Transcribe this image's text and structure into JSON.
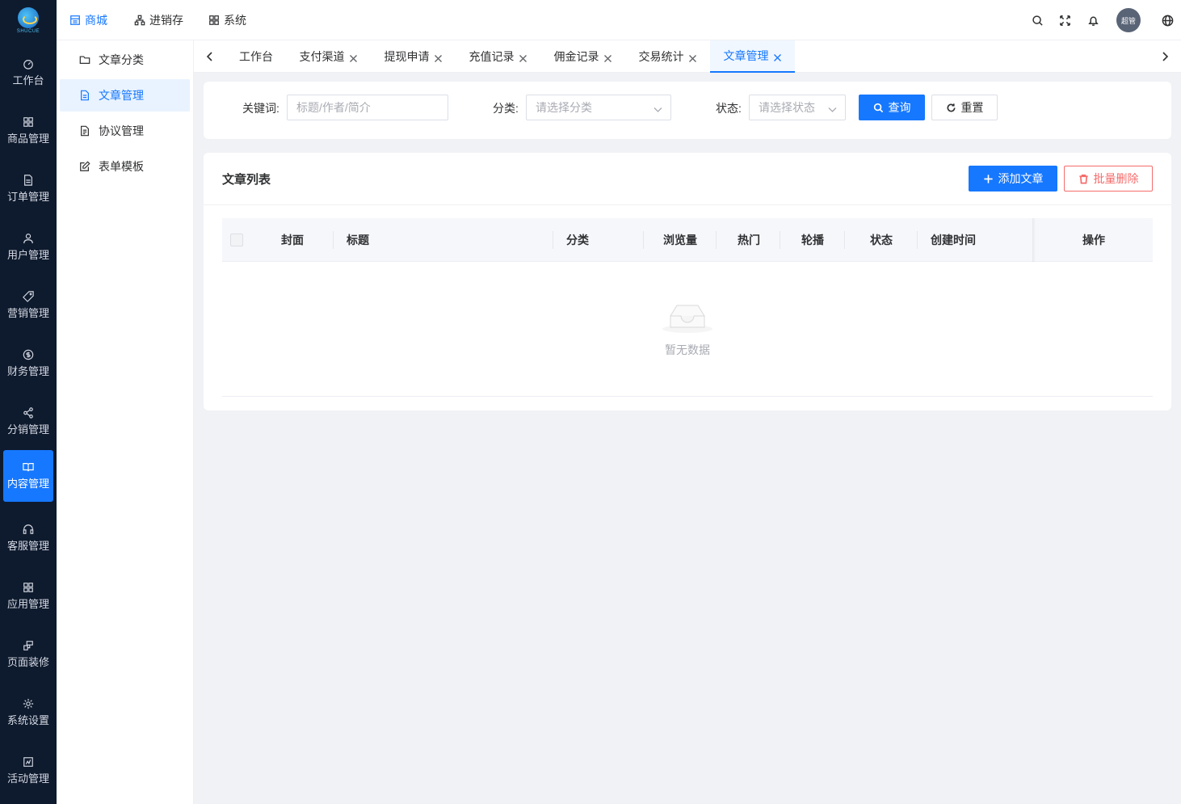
{
  "brand": {
    "logo_text": "SHUCUE"
  },
  "rail": {
    "items": [
      {
        "label": "工作台",
        "icon": "dashboard-icon"
      },
      {
        "label": "商品管理",
        "icon": "grid-icon"
      },
      {
        "label": "订单管理",
        "icon": "document-icon"
      },
      {
        "label": "用户管理",
        "icon": "user-icon"
      },
      {
        "label": "营销管理",
        "icon": "tag-icon"
      },
      {
        "label": "财务管理",
        "icon": "dollar-icon"
      },
      {
        "label": "分销管理",
        "icon": "share-icon"
      },
      {
        "label": "内容管理",
        "icon": "book-icon",
        "active": true
      },
      {
        "label": "客服管理",
        "icon": "headset-icon"
      },
      {
        "label": "应用管理",
        "icon": "apps-icon"
      },
      {
        "label": "页面装修",
        "icon": "brush-icon"
      },
      {
        "label": "系统设置",
        "icon": "gear-icon"
      },
      {
        "label": "活动管理",
        "icon": "activity-icon"
      }
    ]
  },
  "topnav": {
    "items": [
      {
        "label": "商城",
        "icon": "shop-icon",
        "active": true
      },
      {
        "label": "进销存",
        "icon": "hierarchy-icon"
      },
      {
        "label": "系统",
        "icon": "apps-icon"
      }
    ],
    "avatar_label": "超管"
  },
  "submenu": {
    "items": [
      {
        "label": "文章分类",
        "icon": "folder-icon"
      },
      {
        "label": "文章管理",
        "icon": "file-icon",
        "active": true
      },
      {
        "label": "协议管理",
        "icon": "file-text-icon"
      },
      {
        "label": "表单模板",
        "icon": "edit-icon"
      }
    ]
  },
  "tabs": [
    {
      "label": "工作台",
      "closable": false
    },
    {
      "label": "支付渠道",
      "closable": true
    },
    {
      "label": "提现申请",
      "closable": true
    },
    {
      "label": "充值记录",
      "closable": true
    },
    {
      "label": "佣金记录",
      "closable": true
    },
    {
      "label": "交易统计",
      "closable": true
    },
    {
      "label": "文章管理",
      "closable": true,
      "active": true
    }
  ],
  "filter": {
    "keyword_label": "关键词:",
    "keyword_placeholder": "标题/作者/简介",
    "category_label": "分类:",
    "category_placeholder": "请选择分类",
    "status_label": "状态:",
    "status_placeholder": "请选择状态",
    "search_button": "查询",
    "reset_button": "重置"
  },
  "list": {
    "title": "文章列表",
    "add_button": "添加文章",
    "batch_delete_button": "批量删除",
    "columns": [
      "封面",
      "标题",
      "分类",
      "浏览量",
      "热门",
      "轮播",
      "状态",
      "创建时间",
      "操作"
    ],
    "rows": [],
    "empty_text": "暂无数据"
  },
  "colors": {
    "primary": "#1677ff",
    "danger": "#f56c6c",
    "rail_bg": "#0e1a2e"
  }
}
